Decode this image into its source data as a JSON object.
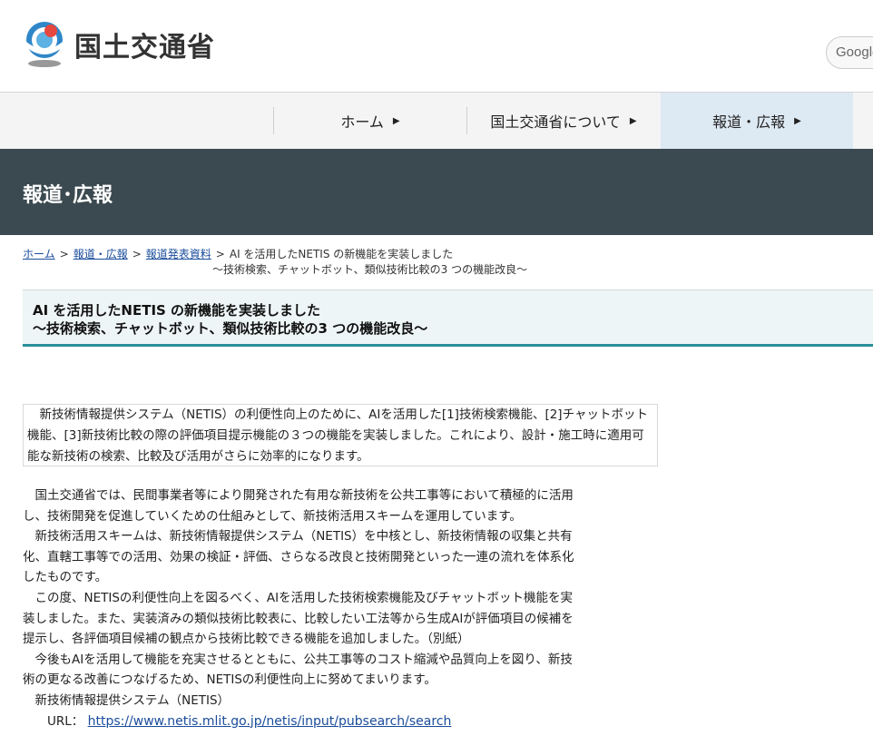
{
  "header": {
    "site_name": "国土交通省",
    "search_label": "Google"
  },
  "nav": {
    "items": [
      {
        "label": "ホーム"
      },
      {
        "label": "国土交通省について"
      },
      {
        "label": "報道・広報"
      }
    ],
    "arrow": "▶"
  },
  "page": {
    "section_title": "報道･広報"
  },
  "breadcrumb": {
    "home": "ホーム",
    "press": "報道・広報",
    "releases": "報道発表資料",
    "separator": ">",
    "current_line1": "AI を活用したNETIS の新機能を実装しました",
    "current_line2": "～技術検索、チャットボット、類似技術比較の3 つの機能改良～"
  },
  "article": {
    "title_line1": "AI を活用したNETIS の新機能を実装しました",
    "title_line2": "～技術検索、チャットボット、類似技術比較の3 つの機能改良～",
    "summary": "　新技術情報提供システム（NETIS）の利便性向上のために、AIを活用した[1]技術検索機能、[2]チャットボット機能、[3]新技術比較の際の評価項目提示機能の３つの機能を実装しました。これにより、設計・施工時に適用可能な新技術の検索、比較及び活用がさらに効率的になります。",
    "paragraphs": [
      "　国土交通省では、民間事業者等により開発された有用な新技術を公共工事等において積極的に活用し、技術開発を促進していくための仕組みとして、新技術活用スキームを運用しています。",
      "　新技術活用スキームは、新技術情報提供システム（NETIS）を中核とし、新技術情報の収集と共有化、直轄工事等での活用、効果の検証・評価、さらなる改良と技術開発といった一連の流れを体系化したものです。",
      "　この度、NETISの利便性向上を図るべく、AIを活用した技術検索機能及びチャットボット機能を実装しました。また、実装済みの類似技術比較表に、比較したい工法等から生成AIが評価項目の候補を提示し、各評価項目候補の観点から技術比較できる機能を追加しました。（別紙）",
      "　今後もAIを活用して機能を充実させるとともに、公共工事等のコスト縮減や品質向上を図り、新技術の更なる改善につなげるため、NETISの利便性向上に努めてまいります。",
      "　新技術情報提供システム（NETIS）"
    ],
    "url_label": "　　URL：",
    "url": "https://www.netis.mlit.go.jp/netis/input/pubsearch/search"
  }
}
